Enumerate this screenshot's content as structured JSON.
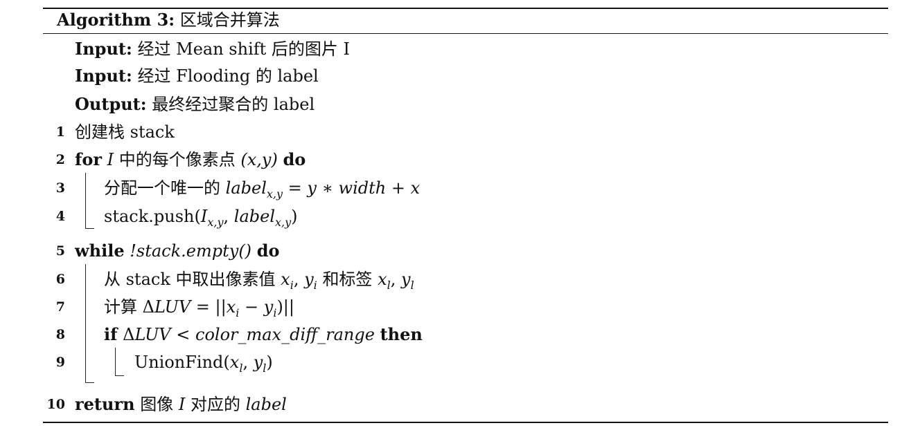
{
  "algorithm": {
    "label": "Algorithm 3:",
    "title": "区域合并算法"
  },
  "io": [
    {
      "keyword": "Input:",
      "text": "经过 Mean shift 后的图片 I"
    },
    {
      "keyword": "Input:",
      "text": "经过 Flooding 的 label"
    },
    {
      "keyword": "Output:",
      "text": "最终经过聚合的 label"
    }
  ],
  "lines": {
    "l1": {
      "num": "1",
      "text": "创建栈 stack"
    },
    "l2": {
      "num": "2",
      "kw_for": "for",
      "var_i": "I",
      "text_mid": "中的每个像素点",
      "var_xy": "(x,y)",
      "kw_do": "do"
    },
    "l3": {
      "num": "3",
      "text": "分配一个唯一的",
      "var_label": "label",
      "sub": "x,y",
      "expr": "= y ∗ width + x"
    },
    "l4": {
      "num": "4",
      "text_pre": "stack.push(",
      "var_i": "I",
      "sub_i": "x,y",
      "sep": ",",
      "var_label": "label",
      "sub_label": "x,y",
      "text_post": ")"
    },
    "l5": {
      "num": "5",
      "kw_while": "while",
      "cond": "!stack.empty()",
      "kw_do": "do"
    },
    "l6": {
      "num": "6",
      "text_pre": "从 stack 中取出像素值",
      "x": "x",
      "sub_xi": "i",
      "comma": ",",
      "y": "y",
      "sub_yi": "i",
      "text_mid": "和标签",
      "x2": "x",
      "sub_xl": "l",
      "comma2": ",",
      "y2": "y",
      "sub_yl": "l"
    },
    "l7": {
      "num": "7",
      "text_pre": "计算 Δ",
      "var_luv": "LUV",
      "eq": " = ||",
      "x": "x",
      "sub_xi": "i",
      "minus": " − ",
      "y": "y",
      "sub_yi": "i",
      "close": ")||"
    },
    "l8": {
      "num": "8",
      "kw_if": "if",
      "delta": "Δ",
      "var_luv": "LUV",
      "lt": " < ",
      "cond": "color_max_diff_range",
      "kw_then": "then"
    },
    "l9": {
      "num": "9",
      "text_pre": "UnionFind(",
      "x": "x",
      "sub_xl": "l",
      "comma": ",",
      "y": "y",
      "sub_yl": "l",
      "close": ")"
    },
    "l10": {
      "num": "10",
      "kw_return": "return",
      "text_mid": "图像",
      "var_i": "I",
      "text_post": "对应的",
      "var_label": "label"
    }
  }
}
